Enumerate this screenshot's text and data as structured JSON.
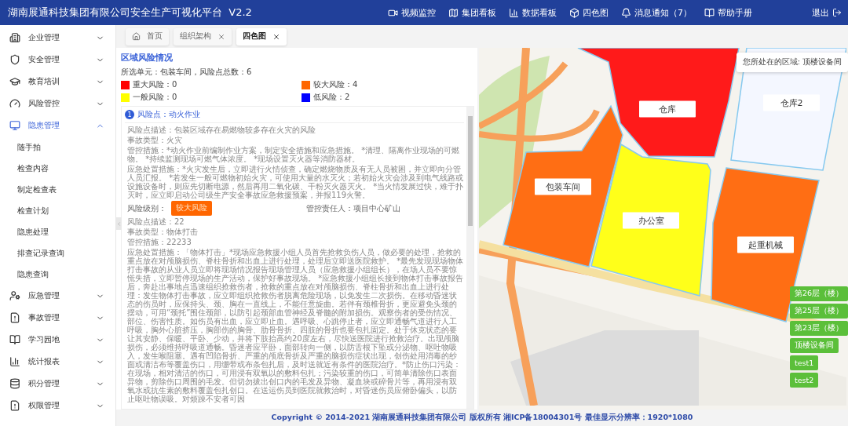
{
  "header": {
    "title": "湖南展通科技集团有限公司安全生产可视化平台  V2.2",
    "nav": [
      {
        "label": "视频监控"
      },
      {
        "label": "集团看板"
      },
      {
        "label": "数据看板"
      },
      {
        "label": "四色图"
      },
      {
        "label": "消息通知（7）"
      },
      {
        "label": "帮助手册"
      }
    ],
    "logout": "退出"
  },
  "sidebar": {
    "items": [
      {
        "label": "企业管理",
        "expanded": false
      },
      {
        "label": "安全管理",
        "expanded": false
      },
      {
        "label": "教育培训",
        "expanded": false
      },
      {
        "label": "风险管控",
        "expanded": false
      },
      {
        "label": "隐患管理",
        "expanded": true,
        "children": [
          {
            "label": "随手拍"
          },
          {
            "label": "检查内容"
          },
          {
            "label": "制定检查表"
          },
          {
            "label": "检查计划"
          },
          {
            "label": "隐患处理"
          },
          {
            "label": "排查记录查询"
          },
          {
            "label": "隐患查询"
          }
        ]
      },
      {
        "label": "应急管理",
        "expanded": false
      },
      {
        "label": "事故管理",
        "expanded": false
      },
      {
        "label": "学习园地",
        "expanded": false
      },
      {
        "label": "统计报表",
        "expanded": false
      },
      {
        "label": "积分管理",
        "expanded": false
      },
      {
        "label": "权限管理",
        "expanded": false
      }
    ]
  },
  "tabs": [
    {
      "label": "首页",
      "selected": false,
      "closable": false
    },
    {
      "label": "组织架构",
      "selected": false,
      "closable": true
    },
    {
      "label": "四色图",
      "selected": true,
      "closable": true
    }
  ],
  "risk_panel": {
    "title": "区域风险情况",
    "summary": "所选单元：包装车间，风险点总数：6",
    "legend": [
      {
        "label": "重大风险：0",
        "color": "#ff0000"
      },
      {
        "label": "较大风险：4",
        "color": "#ff6600"
      },
      {
        "label": "一般风险：0",
        "color": "#ffff00"
      },
      {
        "label": "低风险：2",
        "color": "#0000ff"
      }
    ],
    "risk_points": [
      {
        "number": "1",
        "title": "风险点：动火作业",
        "fields": [
          "风险点描述：包装区域存在易燃物较多存在火灾的风险",
          "事故类型：火灾",
          "管控措施：*动火作业前编制作业方案，制定安全措施和应急措施。 *清理、隔离作业现场的可燃物。 *持续监测现场可燃气体浓度。 *现场设置灭火器等消防器材。",
          "应急处置措施：*火灾发生后，立即进行火情侦查，确定燃烧物质及有无人员被困，并立即向分管人员汇报。 *若发生一般可燃物初始火灾，可使用大量的水灭火；若初始火灾会涉及到电气线路或设施设备时，则应先切断电源，然后再用二氧化碳、干粉灭火器灭火。 *当火情发展过快，难于扑灭时，应立即启动公司级生产安全事故应急救援预案，并报119火警。"
        ],
        "level_label": "风险级别：",
        "level_badge": "较大风险",
        "owner": "管控责任人：项目中心矿山"
      },
      {
        "fields": [
          "风险点描述：22",
          "事故类型：物体打击",
          "管控措施：22233",
          "应急处置措施：「物体打击」*现场应急救援小组人员首先抢救负伤人员，做必要的处理，抢救的重点放在对颅脑损伤、脊柱骨折和出血上进行处理，处理后立即送医院救护。 *最先发现现场物体打击事故的从业人员立即将现场情况报告现场管理人员（应急救援小组组长），在场人员不要惊慌失措，立即暂停现场的生产活动，保护好事故现场。 *应急救援小组组长接到物体打击事故报告后，奔赴出事地点迅速组织抢救伤者，抢救的重点放在对颅脑损伤、脊柱骨折和出血上进行处理：发生物体打击事故，应立即组织抢救伤者脱离危险现场，以免发生二次损伤。在移动昏迷状态的伤员时，应保持头、颈、胸在一直线上，不能任意旋曲。若伴有颈椎骨折，更应避免头颈的摆动，可用“颈托”围住颈部，以防引起颈部血管神经及脊髓的附加损伤。观察伤者的受伤情况、部位、伤害性质。如伤员有出血，应立即止血。遇呼吸、心跳停止者，应立即通畅气道进行人工呼吸，胸外心脏挤压，胸部伤的胸骨、肋骨骨折、四肢的骨折也要包扎固定。处于休克状态的要让其安静、保暖、平卧、少动，并将下肢抬高约20度左右，尽快送医院进行抢救治疗。出现颅脑损伤，必须维持呼吸道通畅。昏迷者应平卧，面部转向一侧，以防舌根下坠或分泌物、呕吐物吸入，发生喉阻塞。遇有凹陷骨折、严重的颅底骨折及严重的脑损伤症状出现，创伤处用消毒的纱面或清洁布等覆盖伤口，用绷带或布条包扎后，及时送就近有条件的医院治疗。*防止伤口污染：在现场，相对清洁的伤口，可用浸有双氧以的敷料包扎；污染较重的伤口，可简单清除伤口表面异物，剪除伤口周围的毛发。但切勿拔出创口内的毛发及异物、凝血块或碎骨片等，再用浸有双氧水或抗生素的敷料覆盖包扎创口。在送运伤员到医院就救治时，对昏迷伤员应俯卧偏头，以防止呕吐物误吸。对烦躁不安者可因"
        ]
      }
    ]
  },
  "map": {
    "location_note": "您所处在的区域: 顶楼设备间",
    "zones": [
      {
        "label": "仓库",
        "color": "#ff1a1a"
      },
      {
        "label": "仓库2",
        "color": "#f4f7ff"
      },
      {
        "label": "包装车间",
        "color": "#ff6e14"
      },
      {
        "label": "办公室",
        "color": "#ffff1a"
      },
      {
        "label": "起重机械",
        "color": "#ff6e14"
      }
    ],
    "floor_buttons": [
      "第26层（楼）",
      "第25层（楼）",
      "第23层（楼）",
      "顶楼设备间",
      "test1",
      "test2"
    ]
  },
  "footer": "Copyright © 2014-2021 湖南展通科技集团有限公司 版权所有 湘ICP备18004301号 最佳显示分辨率：1920*1080"
}
